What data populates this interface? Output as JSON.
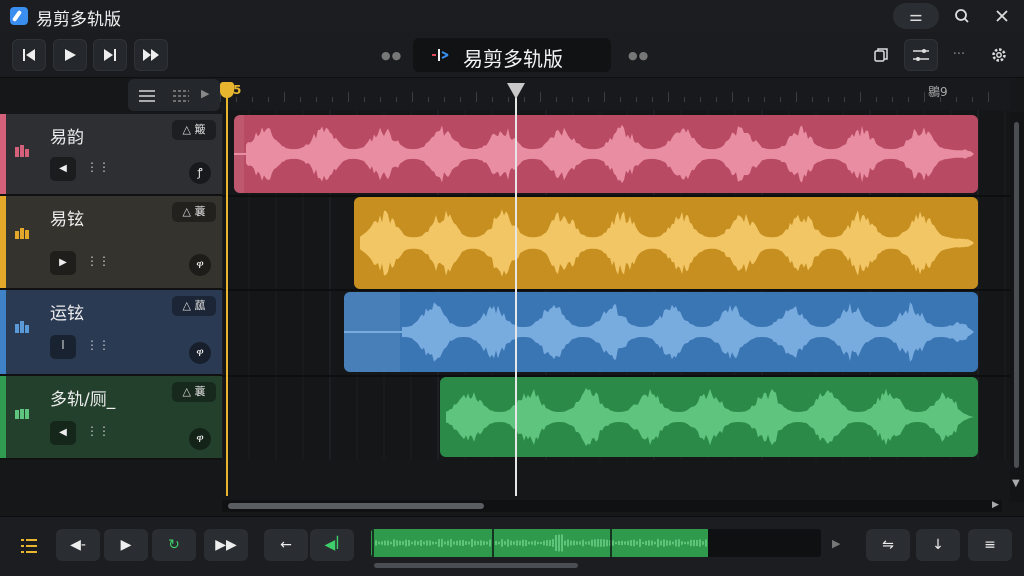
{
  "window": {
    "title": "易剪多轨版",
    "icons": [
      "app-icon",
      "menu-icon",
      "search-icon",
      "close-icon"
    ]
  },
  "toolbar": {
    "center_title": "易剪多轨版",
    "skip_back_icon": "⏮",
    "play_icon": "▶",
    "skip_fwd_icon": "⏭",
    "fast_fwd_icon": "⏩"
  },
  "ruler": {
    "start_label": "5",
    "end_label": "鶍9"
  },
  "tracks": [
    {
      "name": "易韵",
      "tag": "△ 簸",
      "color": "#d4607a",
      "clip_color": "#b94a63",
      "wave_color": "#e98ea2",
      "btn1": "◀",
      "knob": "ꝭ"
    },
    {
      "name": "易铉",
      "tag": "△ 蘘",
      "color": "#e3a72a",
      "clip_color": "#c68f1f",
      "wave_color": "#f2c565",
      "btn1": "▶",
      "knob": "ዋ"
    },
    {
      "name": "运铉",
      "tag": "△ 蓏",
      "color": "#3f82c7",
      "clip_color": "#3a75b4",
      "wave_color": "#78acdf",
      "btn1": "ꟾ",
      "knob": "ዋ"
    },
    {
      "name": "多轨/厕_",
      "tag": "△ 蘘",
      "color": "#2f9c52",
      "clip_color": "#2b8a48",
      "wave_color": "#5fc47d",
      "btn1": "◀",
      "knob": "ዋ"
    }
  ],
  "bottom": {
    "left_icon": "list-icon",
    "b1": "◀-",
    "b2": "▶",
    "b3": "↻",
    "b4": "▶▶",
    "b5": "←",
    "b6": "◀ꟾ",
    "b7": "⇋",
    "b8": "↓",
    "b9": "≡"
  }
}
